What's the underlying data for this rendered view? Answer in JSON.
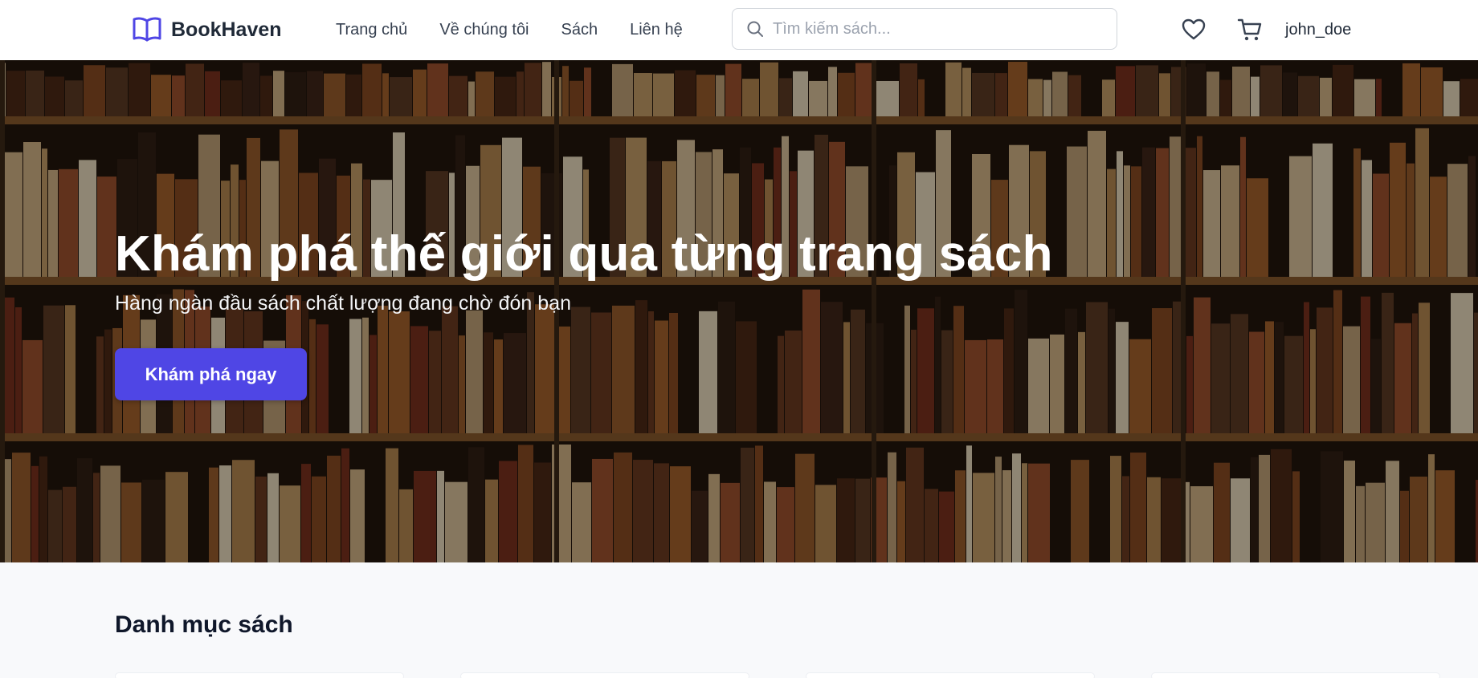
{
  "brand": {
    "name": "BookHaven",
    "accent": "#4f46e5"
  },
  "nav": {
    "items": [
      {
        "label": "Trang chủ"
      },
      {
        "label": "Về chúng tôi"
      },
      {
        "label": "Sách"
      },
      {
        "label": "Liên hệ"
      }
    ]
  },
  "search": {
    "placeholder": "Tìm kiếm sách...",
    "value": ""
  },
  "user": {
    "name": "john_doe"
  },
  "icons": {
    "logo": "open-book-icon",
    "search": "search-icon",
    "wishlist": "heart-icon",
    "cart": "cart-icon"
  },
  "hero": {
    "title": "Khám phá thế giới qua từng trang sách",
    "subtitle": "Hàng ngàn đầu sách chất lượng đang chờ đón bạn",
    "cta_label": "Khám phá ngay"
  },
  "categories": {
    "title": "Danh mục sách"
  }
}
